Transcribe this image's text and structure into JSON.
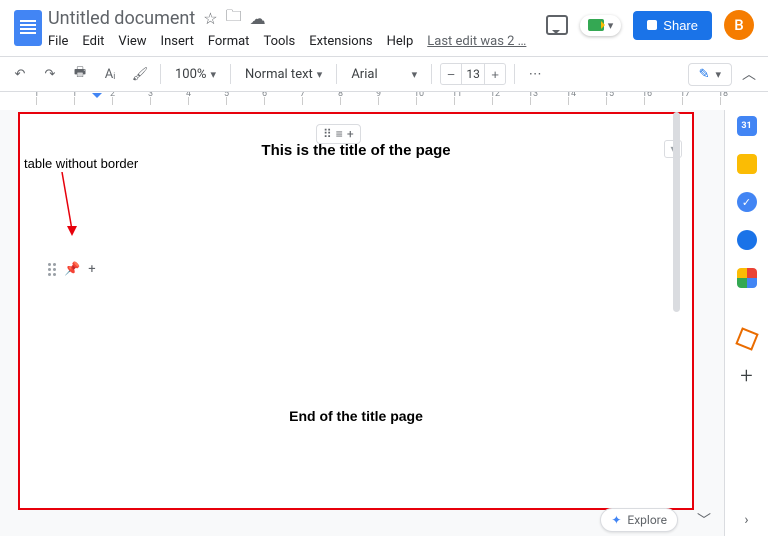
{
  "header": {
    "doc_title": "Untitled document",
    "menus": [
      "File",
      "Edit",
      "View",
      "Insert",
      "Format",
      "Tools",
      "Extensions",
      "Help"
    ],
    "last_edit": "Last edit was 2 …",
    "share": "Share",
    "avatar_initial": "B"
  },
  "toolbar": {
    "zoom": "100%",
    "style": "Normal text",
    "font": "Arial",
    "font_size": "13"
  },
  "ruler": {
    "ticks": [
      "1",
      "1",
      "2",
      "3",
      "4",
      "5",
      "6",
      "7",
      "8",
      "9",
      "10",
      "11",
      "12",
      "13",
      "14",
      "15",
      "16",
      "17",
      "18"
    ]
  },
  "doc": {
    "title_line": "This is the title of the page",
    "end_line": "End of the title page",
    "annotation": "table without border"
  },
  "explore": {
    "label": "Explore"
  }
}
